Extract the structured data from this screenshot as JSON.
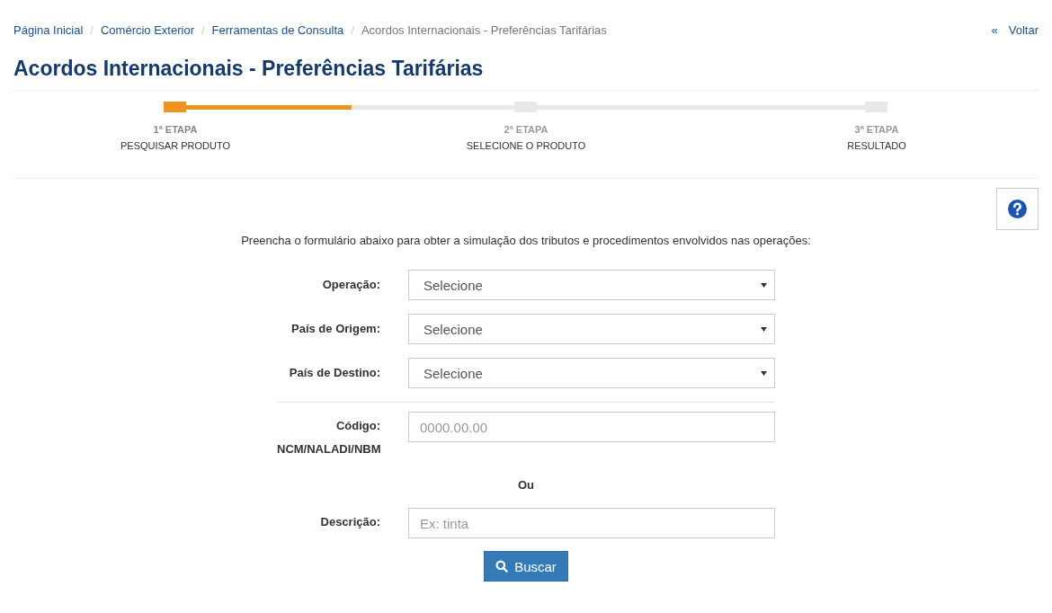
{
  "breadcrumb": [
    {
      "label": "Página Inicial",
      "link": true
    },
    {
      "label": "Comércio Exterior",
      "link": true
    },
    {
      "label": "Ferramentas de Consulta",
      "link": true
    },
    {
      "label": "Acordos Internacionais - Preferências Tarifárias",
      "link": false
    }
  ],
  "breadcrumb_separator": "/",
  "back_link": {
    "icon": "«",
    "label": "Voltar"
  },
  "title": "Acordos Internacionais - Preferências Tarifárias",
  "progress": {
    "level": 0.26
  },
  "steps": [
    {
      "number": "1ª ETAPA",
      "label": "PESQUISAR PRODUTO",
      "active": true
    },
    {
      "number": "2ª ETAPA",
      "label": "SELECIONE O PRODUTO",
      "active": false
    },
    {
      "number": "3ª ETAPA",
      "label": "RESULTADO",
      "active": false
    }
  ],
  "intro": "Preencha o formulário abaixo para obter a simulação dos tributos e procedimentos envolvidos nas operações:",
  "form": [
    {
      "kind": "select",
      "label": "Operação:",
      "value": "Selecione"
    },
    {
      "kind": "select",
      "label": "País de Origem:",
      "value": "Selecione"
    },
    {
      "kind": "select",
      "label": "País de Destino:",
      "value": "Selecione"
    },
    {
      "kind": "divider"
    },
    {
      "kind": "text",
      "label": "Código: NCM/NALADI/NBM",
      "placeholder": "0000.00.00"
    },
    {
      "kind": "or",
      "label": "Ou"
    },
    {
      "kind": "text",
      "label": "Descrição:",
      "placeholder": "Ex: tinta"
    }
  ],
  "search_button": "Buscar"
}
